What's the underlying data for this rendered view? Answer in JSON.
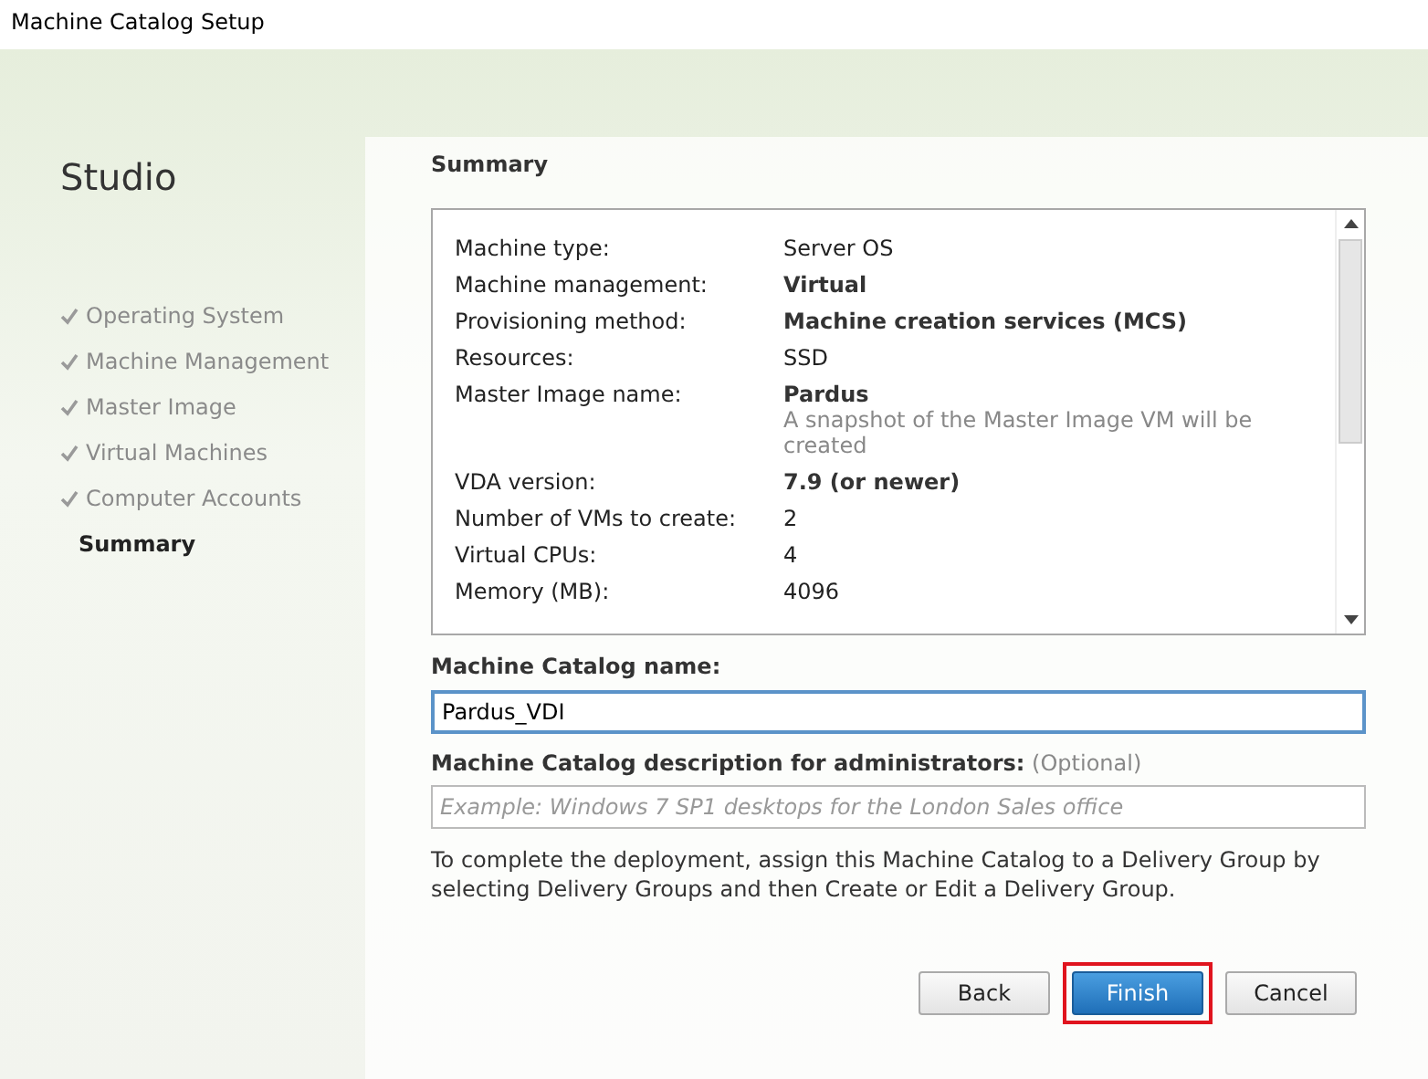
{
  "window": {
    "title": "Machine Catalog Setup"
  },
  "sidebar": {
    "title": "Studio",
    "steps": [
      {
        "label": "Operating System",
        "completed": true,
        "selected": false
      },
      {
        "label": "Machine Management",
        "completed": true,
        "selected": false
      },
      {
        "label": "Master Image",
        "completed": true,
        "selected": false
      },
      {
        "label": "Virtual Machines",
        "completed": true,
        "selected": false
      },
      {
        "label": "Computer Accounts",
        "completed": true,
        "selected": false
      },
      {
        "label": "Summary",
        "completed": false,
        "selected": true
      }
    ]
  },
  "heading": "Summary",
  "summary_rows": [
    {
      "label": "Machine type:",
      "value": "Server OS",
      "bold": false
    },
    {
      "label": "Machine management:",
      "value": "Virtual",
      "bold": true
    },
    {
      "label": "Provisioning method:",
      "value": "Machine creation services (MCS)",
      "bold": true
    },
    {
      "label": "Resources:",
      "value": "SSD",
      "bold": false
    },
    {
      "label": "Master Image name:",
      "value": "Pardus",
      "bold": true,
      "note": "A snapshot of the Master Image VM will be created"
    },
    {
      "label": "VDA version:",
      "value": "7.9 (or newer)",
      "bold": true
    },
    {
      "label": "Number of VMs to create:",
      "value": "2",
      "bold": false
    },
    {
      "label": "Virtual CPUs:",
      "value": "4",
      "bold": false
    },
    {
      "label": "Memory (MB):",
      "value": "4096",
      "bold": false
    }
  ],
  "name_field": {
    "label": "Machine Catalog name:",
    "value": "Pardus_VDI"
  },
  "description_field": {
    "label": "Machine Catalog description for administrators:",
    "optional": "(Optional)",
    "placeholder": "Example: Windows 7 SP1 desktops for the London Sales office"
  },
  "info_text": "To complete the deployment, assign this Machine Catalog to a Delivery Group by selecting Delivery Groups and then Create or Edit a Delivery Group.",
  "buttons": [
    {
      "label": "Back",
      "kind": "secondary",
      "highlighted": false
    },
    {
      "label": "Finish",
      "kind": "primary",
      "highlighted": true
    },
    {
      "label": "Cancel",
      "kind": "secondary",
      "highlighted": false
    }
  ]
}
